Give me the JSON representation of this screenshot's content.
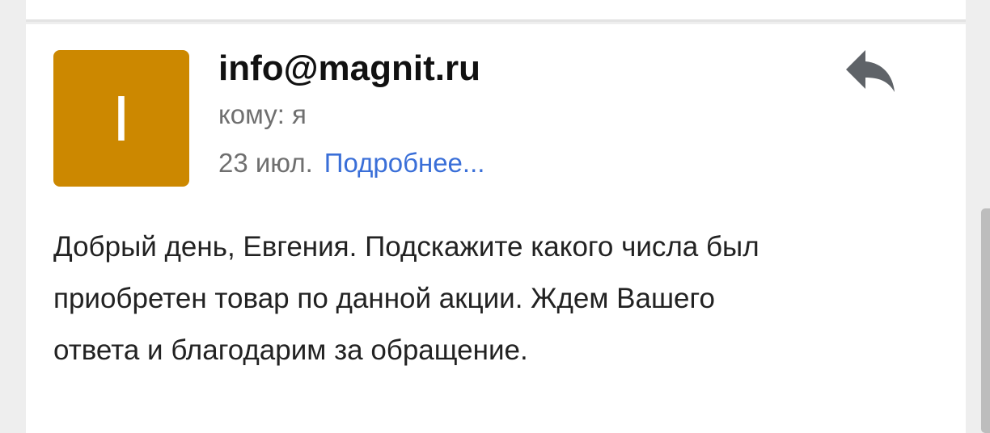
{
  "message": {
    "avatar_letter": "I",
    "avatar_color": "#cc8800",
    "sender": "info@magnit.ru",
    "recipient": "кому: я",
    "date": "23 июл.",
    "details_link": "Подробнее...",
    "reply_icon": "reply-icon",
    "body_lines": [
      "Добрый день, Евгения. Подскажите какого числа был",
      "приобретен товар по данной акции. Ждем Вашего",
      "ответа и благодарим за обращение."
    ]
  },
  "colors": {
    "link": "#3a6fd8",
    "secondary_text": "#6f6f6f",
    "primary_text": "#111111"
  }
}
